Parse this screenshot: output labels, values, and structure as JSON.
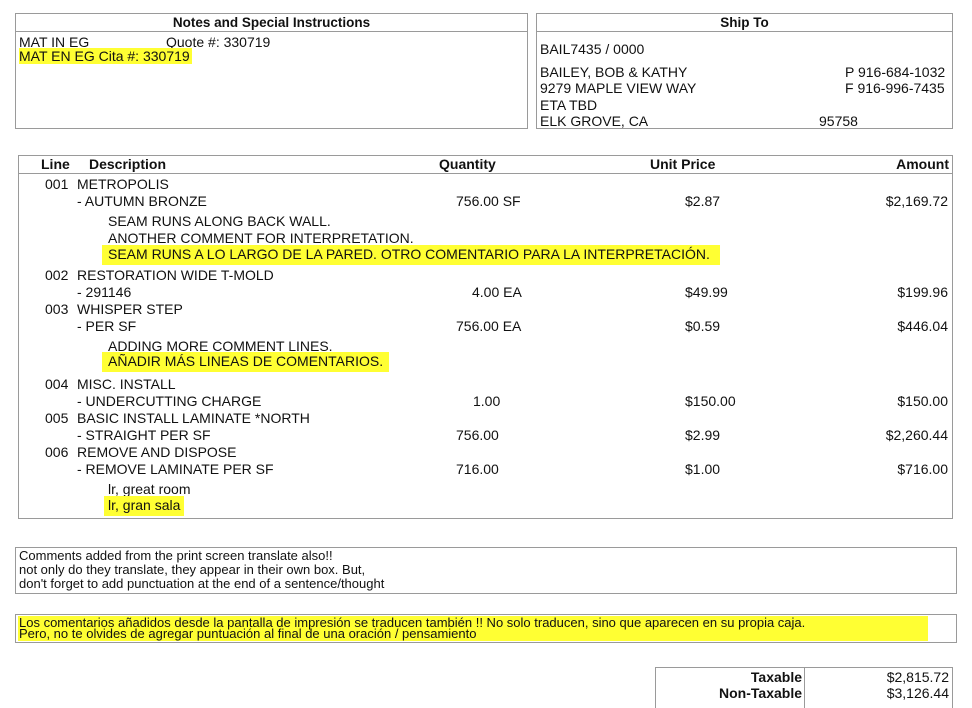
{
  "notes": {
    "header": "Notes and Special Instructions",
    "line1_left": "MAT IN EG",
    "line1_right": "Quote #: 330719",
    "line2": "MAT EN EG Cita #: 330719"
  },
  "ship_to": {
    "header": "Ship To",
    "account": "BAIL7435 / 0000",
    "name": "BAILEY, BOB & KATHY",
    "phone": "P 916-684-1032",
    "street": "9279 MAPLE VIEW WAY",
    "fax": "F 916-996-7435",
    "eta": "ETA TBD",
    "city": "ELK GROVE, CA",
    "zip": "95758"
  },
  "table": {
    "headers": {
      "line": "Line",
      "description": "Description",
      "quantity": "Quantity",
      "unit_price": "Unit Price",
      "amount": "Amount"
    },
    "items": [
      {
        "line": "001",
        "title": "METROPOLIS",
        "sub": "- AUTUMN BRONZE",
        "qty": "756.00 SF",
        "price": "$2.87",
        "amount": "$2,169.72",
        "comments": [
          "SEAM RUNS ALONG BACK WALL.",
          "ANOTHER COMMENT FOR INTERPRETATION."
        ],
        "translated": "SEAM RUNS A LO LARGO DE LA PARED. OTRO COMENTARIO PARA LA INTERPRETACIÓN."
      },
      {
        "line": "002",
        "title": "RESTORATION WIDE T-MOLD",
        "sub": "- 291146",
        "qty": "4.00 EA",
        "price": "$49.99",
        "amount": "$199.96"
      },
      {
        "line": "003",
        "title": "WHISPER STEP",
        "sub": "- PER SF",
        "qty": "756.00 EA",
        "price": "$0.59",
        "amount": "$446.04",
        "comments": [
          "ADDING MORE COMMENT LINES."
        ],
        "translated": "AÑADIR MÁS LINEAS DE COMENTARIOS."
      },
      {
        "line": "004",
        "title": "MISC. INSTALL",
        "sub": "- UNDERCUTTING CHARGE",
        "qty": "1.00",
        "price": "$150.00",
        "amount": "$150.00"
      },
      {
        "line": "005",
        "title": "BASIC INSTALL LAMINATE *NORTH",
        "sub": "- STRAIGHT PER SF",
        "qty": "756.00",
        "price": "$2.99",
        "amount": "$2,260.44"
      },
      {
        "line": "006",
        "title": "REMOVE AND DISPOSE",
        "sub": "- REMOVE LAMINATE PER SF",
        "qty": "716.00",
        "price": "$1.00",
        "amount": "$716.00",
        "comments": [
          "lr, great room"
        ],
        "translated": "lr, gran sala"
      }
    ]
  },
  "comments_box": {
    "lines": [
      "Comments added from the print screen translate also!!",
      "not only do they translate, they appear in their own box. But,",
      "don't forget to add punctuation at the end of a sentence/thought"
    ]
  },
  "translated_box": {
    "lines": [
      "Los comentarios añadidos desde la pantalla de impresión se traducen también !! No solo traducen, sino que aparecen en su propia caja.",
      "Pero, no te olvides de agregar puntuación al final de una oración / pensamiento"
    ]
  },
  "totals": {
    "taxable_label": "Taxable",
    "taxable_value": "$2,815.72",
    "nontaxable_label": "Non-Taxable",
    "nontaxable_value": "$3,126.44"
  },
  "colors": {
    "highlight": "#ffff33",
    "border": "#9a9a9a"
  }
}
